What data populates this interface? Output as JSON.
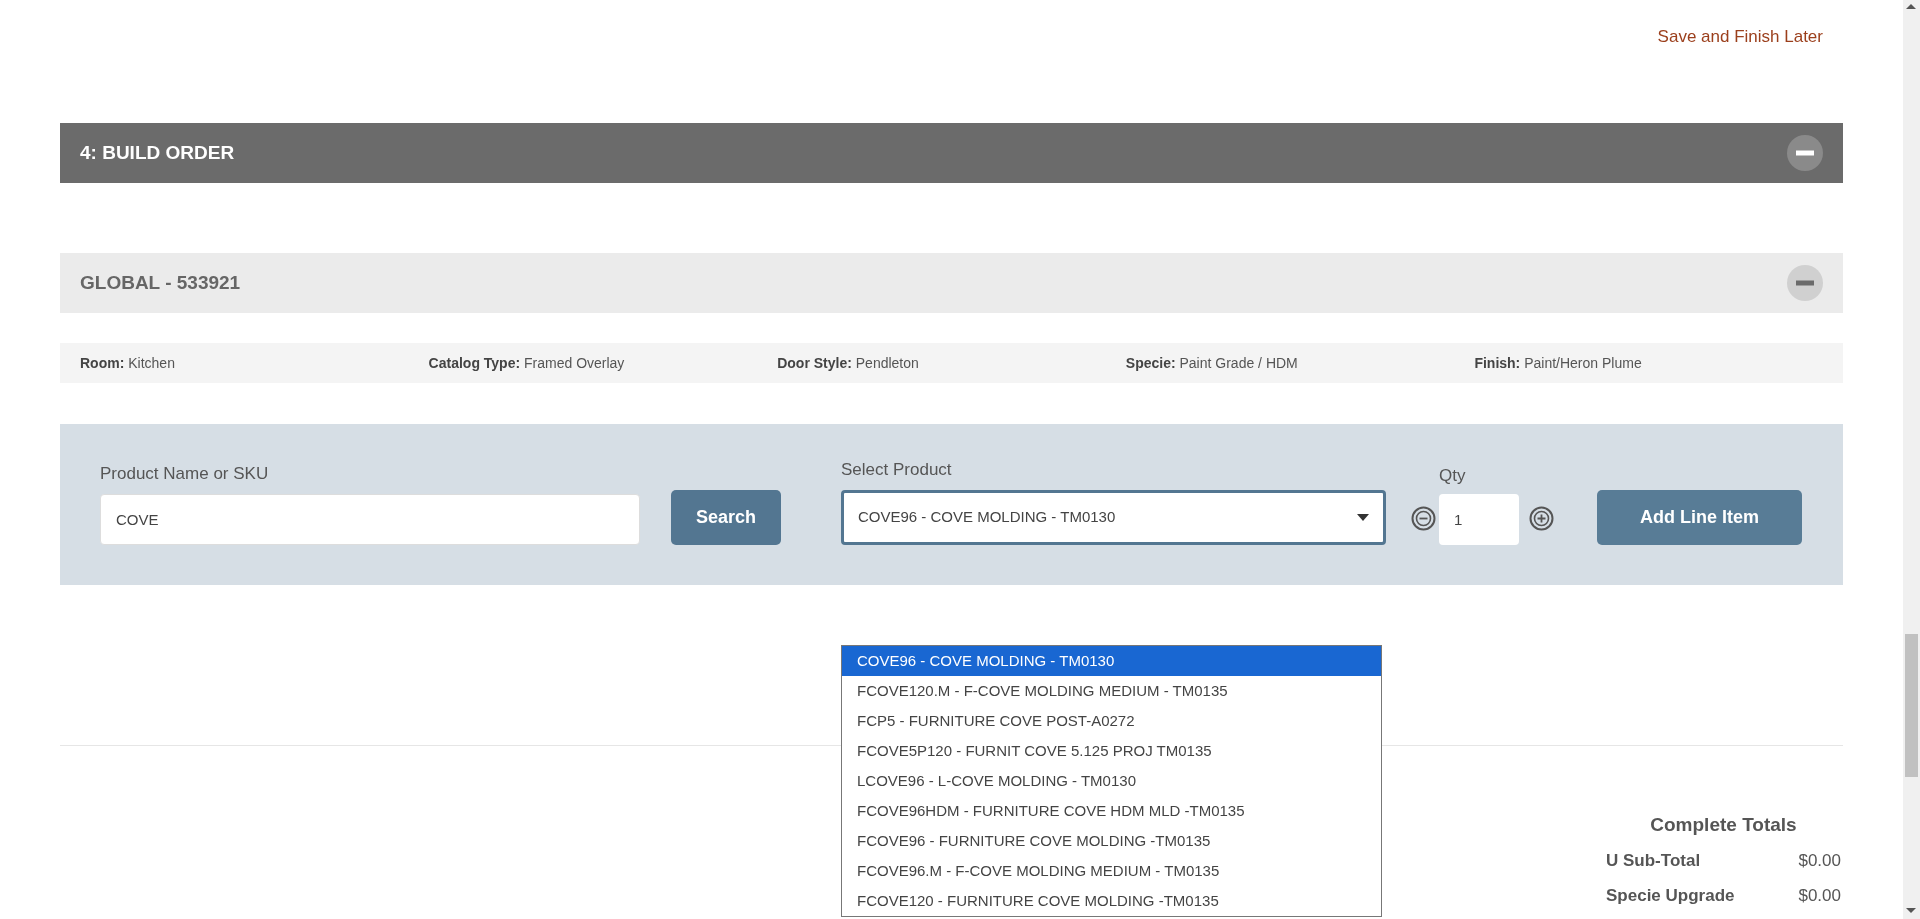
{
  "header_link": "Save and Finish Later",
  "section": {
    "title": "4: BUILD ORDER",
    "expanded": true
  },
  "group": {
    "title": "GLOBAL - 533921",
    "expanded": true
  },
  "details": [
    {
      "label": "Room:",
      "value": "Kitchen"
    },
    {
      "label": "Catalog Type:",
      "value": "Framed Overlay"
    },
    {
      "label": "Door Style:",
      "value": "Pendleton"
    },
    {
      "label": "Specie:",
      "value": "Paint Grade / HDM"
    },
    {
      "label": "Finish:",
      "value": "Paint/Heron Plume"
    }
  ],
  "search": {
    "label": "Product Name or SKU",
    "value": "COVE",
    "button": "Search"
  },
  "product_select": {
    "label": "Select Product",
    "value": "COVE96 - COVE MOLDING - TM0130",
    "expanded": true
  },
  "qty": {
    "label": "Qty",
    "value": "1"
  },
  "add_button": "Add Line Item",
  "dropdown_options": [
    {
      "text": "COVE96 - COVE MOLDING - TM0130",
      "selected": true
    },
    {
      "text": "FCOVE120.M - F-COVE MOLDING MEDIUM - TM0135",
      "selected": false
    },
    {
      "text": "FCP5 - FURNITURE COVE POST-A0272",
      "selected": false
    },
    {
      "text": "FCOVE5P120 - FURNIT COVE 5.125 PROJ TM0135",
      "selected": false
    },
    {
      "text": "LCOVE96 - L-COVE MOLDING - TM0130",
      "selected": false
    },
    {
      "text": "FCOVE96HDM - FURNITURE COVE HDM MLD -TM0135",
      "selected": false
    },
    {
      "text": "FCOVE96 - FURNITURE COVE MOLDING -TM0135",
      "selected": false
    },
    {
      "text": "FCOVE96.M - F-COVE MOLDING MEDIUM - TM0135",
      "selected": false
    },
    {
      "text": "FCOVE120 - FURNITURE COVE MOLDING -TM0135",
      "selected": false
    }
  ],
  "totals": {
    "title": "Complete Totals",
    "rows": [
      {
        "label": "U Sub-Total",
        "value": "$0.00"
      },
      {
        "label": "Specie Upgrade",
        "value": "$0.00"
      }
    ]
  }
}
